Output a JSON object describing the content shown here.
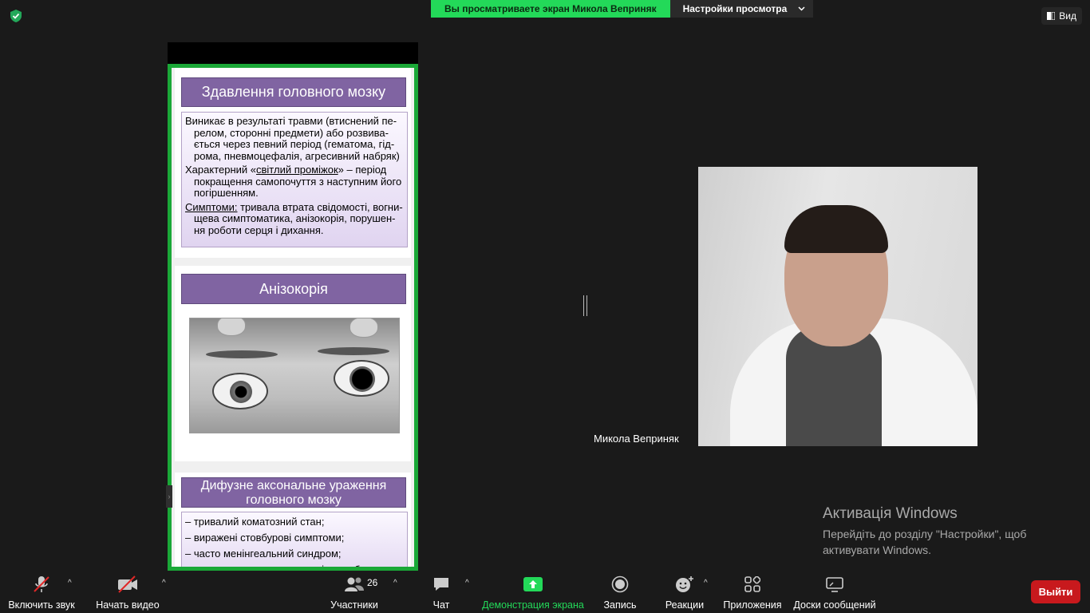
{
  "header": {
    "viewing_banner": "Вы просматриваете экран Микола Веприняк",
    "view_settings": "Настройки просмотра",
    "view_button": "Вид",
    "encryption_icon": "shield-check-icon",
    "accent_green": "#23d959"
  },
  "slides": [
    {
      "title": "Здавлення головного мозку",
      "paragraphs": [
        "Виникає в результаті травми (втиснений пе-релом, сторонні предмети) або розвива-ється через певний період (гематома, гід-рома, пневмоцефалія, агресивний набряк)",
        {
          "prefix": "Характерний «",
          "underlined": "світлий проміжок",
          "suffix": "» – період покращення самопочуття з наступним його погіршенням."
        },
        {
          "underlined": "Симптоми:",
          "suffix": " тривала втрата свідомості, вогни-щева симптоматика, анізокорія, порушен-ня роботи серця і дихання."
        }
      ]
    },
    {
      "title": "Анізокорія",
      "image": "anisocoria-eyes-photo"
    },
    {
      "title": "Дифузне аксональне ураження головного мозку",
      "items": [
        "– тривалий коматозний стан;",
        "– виражені стовбурові симптоми;",
        "– часто менінгеальний синдром;",
        "– часто розлади дихання, які потребують"
      ]
    }
  ],
  "participant": {
    "name": "Микола Веприняк"
  },
  "activation": {
    "title": "Активація Windows",
    "line1": "Перейдіть до розділу \"Настройки\", щоб",
    "line2": "активувати Windows."
  },
  "toolbar": {
    "unmute": "Включить звук",
    "start_video": "Начать видео",
    "participants": "Участники",
    "participants_count": "26",
    "chat": "Чат",
    "share_screen": "Демонстрация экрана",
    "record": "Запись",
    "reactions": "Реакции",
    "apps": "Приложения",
    "whiteboards": "Доски сообщений",
    "leave": "Выйти",
    "leave_color": "#c8191d"
  }
}
